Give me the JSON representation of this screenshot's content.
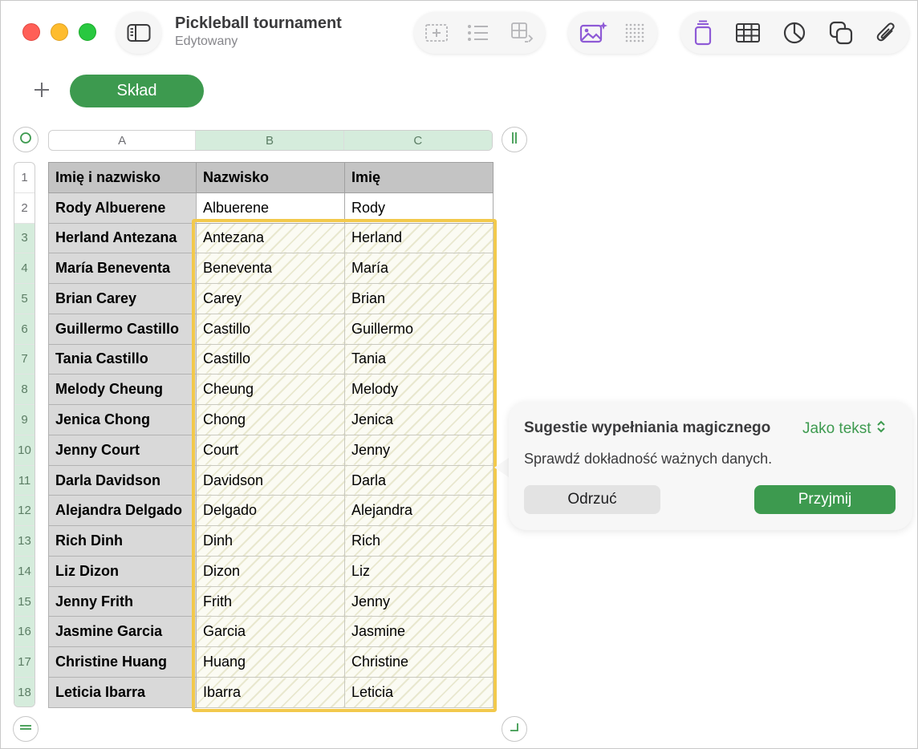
{
  "document": {
    "title": "Pickleball tournament",
    "status": "Edytowany"
  },
  "toolbar": {
    "groups": [
      [
        "text-box-icon",
        "list-icon",
        "table-layout-icon"
      ],
      [
        "magic-image-icon",
        "grid-dots-icon"
      ],
      [
        "shape-icon",
        "table-icon",
        "chart-icon",
        "copy-icon",
        "attachment-icon"
      ]
    ],
    "accent": "#8e5ad6"
  },
  "sheets": {
    "add_label": "+",
    "active_tab": "Skład"
  },
  "table": {
    "columns": [
      "A",
      "B",
      "C"
    ],
    "selected_columns": [
      1,
      2
    ],
    "row_numbers": [
      "1",
      "2",
      "3",
      "4",
      "5",
      "6",
      "7",
      "8",
      "9",
      "10",
      "11",
      "12",
      "13",
      "14",
      "15",
      "16",
      "17",
      "18"
    ],
    "header": [
      "Imię i nazwisko",
      "Nazwisko",
      "Imię"
    ],
    "rows": [
      [
        "Rody Albuerene",
        "Albuerene",
        "Rody"
      ],
      [
        "Herland Antezana",
        "Antezana",
        "Herland"
      ],
      [
        "María Beneventa",
        "Beneventa",
        "María"
      ],
      [
        "Brian Carey",
        "Carey",
        "Brian"
      ],
      [
        "Guillermo Castillo",
        "Castillo",
        "Guillermo"
      ],
      [
        "Tania Castillo",
        "Castillo",
        "Tania"
      ],
      [
        "Melody Cheung",
        "Cheung",
        "Melody"
      ],
      [
        "Jenica Chong",
        "Chong",
        "Jenica"
      ],
      [
        "Jenny Court",
        "Court",
        "Jenny"
      ],
      [
        "Darla Davidson",
        "Davidson",
        "Darla"
      ],
      [
        "Alejandra Delgado",
        "Delgado",
        "Alejandra"
      ],
      [
        "Rich Dinh",
        "Dinh",
        "Rich"
      ],
      [
        "Liz Dizon",
        "Dizon",
        "Liz"
      ],
      [
        "Jenny Frith",
        "Frith",
        "Jenny"
      ],
      [
        "Jasmine Garcia",
        "Garcia",
        "Jasmine"
      ],
      [
        "Christine Huang",
        "Huang",
        "Christine"
      ],
      [
        "Leticia Ibarra",
        "Ibarra",
        "Leticia"
      ]
    ],
    "suggested_from_row": 3,
    "highlight_color": "#f2c94c"
  },
  "suggestion": {
    "title": "Sugestie wypełniania magicznego",
    "mode": "Jako tekst",
    "message": "Sprawdź dokładność ważnych danych.",
    "reject_label": "Odrzuć",
    "accept_label": "Przyjmij"
  }
}
